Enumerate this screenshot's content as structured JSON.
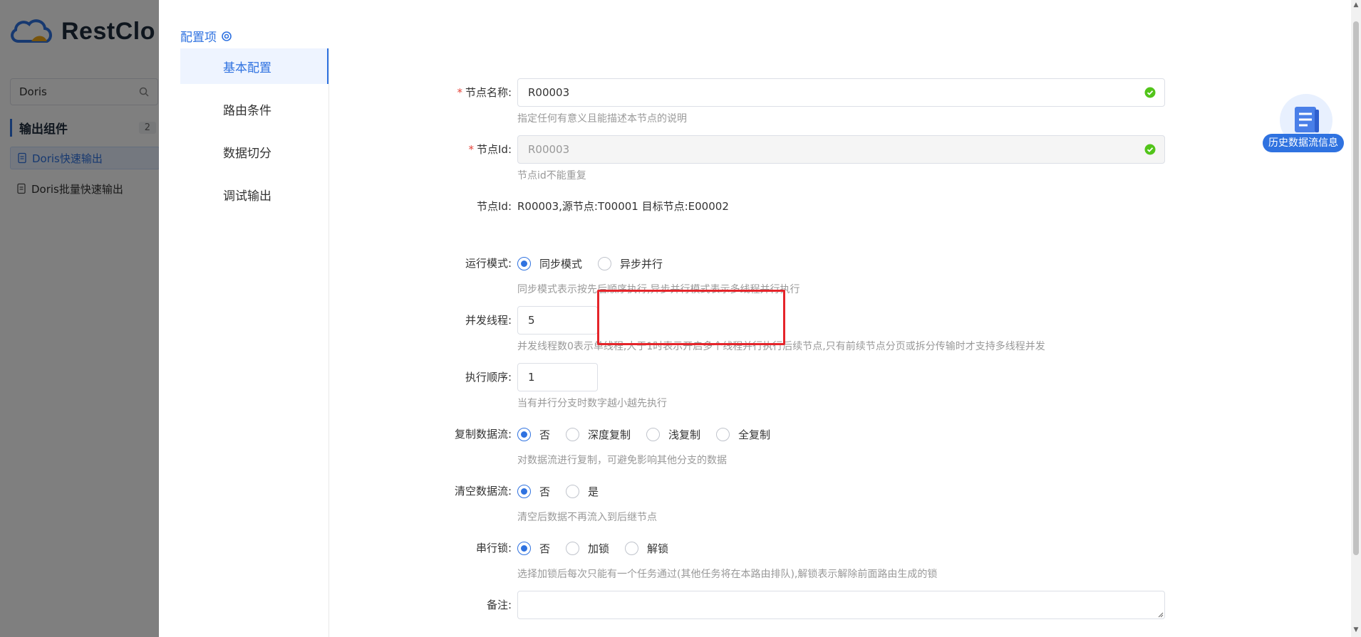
{
  "background": {
    "logo_text": "RestClo",
    "search_value": "Doris",
    "group_title": "输出组件",
    "group_count": "2",
    "items": [
      {
        "label": "Doris快速输出",
        "active": true
      },
      {
        "label": "Doris批量快速输出",
        "active": false
      }
    ]
  },
  "drawer": {
    "config_title": "配置项",
    "tabs": [
      "基本配置",
      "路由条件",
      "数据切分",
      "调试输出"
    ],
    "form": {
      "node_name": {
        "label": "节点名称:",
        "value": "R00003",
        "help": "指定任何有意义且能描述本节点的说明"
      },
      "node_id": {
        "label": "节点Id:",
        "value": "R00003",
        "help": "节点id不能重复"
      },
      "node_id_info": {
        "label": "节点Id:",
        "value": "R00003,源节点:T00001 目标节点:E00002"
      },
      "run_mode": {
        "label": "运行模式:",
        "options": [
          "同步模式",
          "异步并行"
        ],
        "help": "同步模式表示按先后顺序执行,异步并行模式表示多线程并行执行"
      },
      "threads": {
        "label": "并发线程:",
        "value": "5",
        "help": "并发线程数0表示单线程,大于1时表示开启多个线程并行执行后续节点,只有前续节点分页或拆分传输时才支持多线程并发"
      },
      "exec_order": {
        "label": "执行顺序:",
        "value": "1",
        "help": "当有并行分支时数字越小越先执行"
      },
      "copy_flow": {
        "label": "复制数据流:",
        "options": [
          "否",
          "深度复制",
          "浅复制",
          "全复制"
        ],
        "help": "对数据流进行复制，可避免影响其他分支的数据"
      },
      "clear_flow": {
        "label": "清空数据流:",
        "options": [
          "否",
          "是"
        ],
        "help": "清空后数据不再流入到后继节点"
      },
      "serial_lock": {
        "label": "串行锁:",
        "options": [
          "否",
          "加锁",
          "解锁"
        ],
        "help": "选择加锁后每次只能有一个任务通过(其他任务将在本路由排队),解锁表示解除前面路由生成的锁"
      },
      "remark": {
        "label": "备注:",
        "value": ""
      }
    },
    "float_button": "历史数据流信息"
  },
  "colors": {
    "accent": "#2f72e0",
    "required": "#e5443a",
    "highlight": "#e5242a",
    "success": "#52c41a"
  }
}
